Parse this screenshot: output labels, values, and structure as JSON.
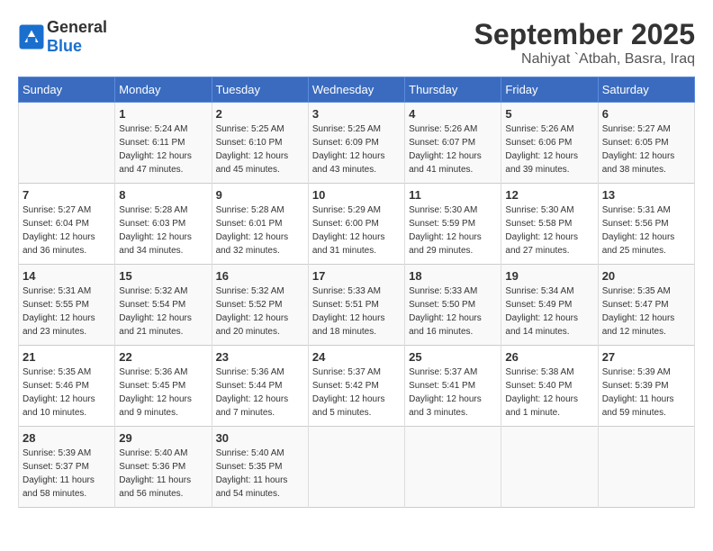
{
  "header": {
    "logo_general": "General",
    "logo_blue": "Blue",
    "month": "September 2025",
    "location": "Nahiyat `Atbah, Basra, Iraq"
  },
  "days_of_week": [
    "Sunday",
    "Monday",
    "Tuesday",
    "Wednesday",
    "Thursday",
    "Friday",
    "Saturday"
  ],
  "weeks": [
    [
      {
        "day": "",
        "info": ""
      },
      {
        "day": "1",
        "info": "Sunrise: 5:24 AM\nSunset: 6:11 PM\nDaylight: 12 hours\nand 47 minutes."
      },
      {
        "day": "2",
        "info": "Sunrise: 5:25 AM\nSunset: 6:10 PM\nDaylight: 12 hours\nand 45 minutes."
      },
      {
        "day": "3",
        "info": "Sunrise: 5:25 AM\nSunset: 6:09 PM\nDaylight: 12 hours\nand 43 minutes."
      },
      {
        "day": "4",
        "info": "Sunrise: 5:26 AM\nSunset: 6:07 PM\nDaylight: 12 hours\nand 41 minutes."
      },
      {
        "day": "5",
        "info": "Sunrise: 5:26 AM\nSunset: 6:06 PM\nDaylight: 12 hours\nand 39 minutes."
      },
      {
        "day": "6",
        "info": "Sunrise: 5:27 AM\nSunset: 6:05 PM\nDaylight: 12 hours\nand 38 minutes."
      }
    ],
    [
      {
        "day": "7",
        "info": "Sunrise: 5:27 AM\nSunset: 6:04 PM\nDaylight: 12 hours\nand 36 minutes."
      },
      {
        "day": "8",
        "info": "Sunrise: 5:28 AM\nSunset: 6:03 PM\nDaylight: 12 hours\nand 34 minutes."
      },
      {
        "day": "9",
        "info": "Sunrise: 5:28 AM\nSunset: 6:01 PM\nDaylight: 12 hours\nand 32 minutes."
      },
      {
        "day": "10",
        "info": "Sunrise: 5:29 AM\nSunset: 6:00 PM\nDaylight: 12 hours\nand 31 minutes."
      },
      {
        "day": "11",
        "info": "Sunrise: 5:30 AM\nSunset: 5:59 PM\nDaylight: 12 hours\nand 29 minutes."
      },
      {
        "day": "12",
        "info": "Sunrise: 5:30 AM\nSunset: 5:58 PM\nDaylight: 12 hours\nand 27 minutes."
      },
      {
        "day": "13",
        "info": "Sunrise: 5:31 AM\nSunset: 5:56 PM\nDaylight: 12 hours\nand 25 minutes."
      }
    ],
    [
      {
        "day": "14",
        "info": "Sunrise: 5:31 AM\nSunset: 5:55 PM\nDaylight: 12 hours\nand 23 minutes."
      },
      {
        "day": "15",
        "info": "Sunrise: 5:32 AM\nSunset: 5:54 PM\nDaylight: 12 hours\nand 21 minutes."
      },
      {
        "day": "16",
        "info": "Sunrise: 5:32 AM\nSunset: 5:52 PM\nDaylight: 12 hours\nand 20 minutes."
      },
      {
        "day": "17",
        "info": "Sunrise: 5:33 AM\nSunset: 5:51 PM\nDaylight: 12 hours\nand 18 minutes."
      },
      {
        "day": "18",
        "info": "Sunrise: 5:33 AM\nSunset: 5:50 PM\nDaylight: 12 hours\nand 16 minutes."
      },
      {
        "day": "19",
        "info": "Sunrise: 5:34 AM\nSunset: 5:49 PM\nDaylight: 12 hours\nand 14 minutes."
      },
      {
        "day": "20",
        "info": "Sunrise: 5:35 AM\nSunset: 5:47 PM\nDaylight: 12 hours\nand 12 minutes."
      }
    ],
    [
      {
        "day": "21",
        "info": "Sunrise: 5:35 AM\nSunset: 5:46 PM\nDaylight: 12 hours\nand 10 minutes."
      },
      {
        "day": "22",
        "info": "Sunrise: 5:36 AM\nSunset: 5:45 PM\nDaylight: 12 hours\nand 9 minutes."
      },
      {
        "day": "23",
        "info": "Sunrise: 5:36 AM\nSunset: 5:44 PM\nDaylight: 12 hours\nand 7 minutes."
      },
      {
        "day": "24",
        "info": "Sunrise: 5:37 AM\nSunset: 5:42 PM\nDaylight: 12 hours\nand 5 minutes."
      },
      {
        "day": "25",
        "info": "Sunrise: 5:37 AM\nSunset: 5:41 PM\nDaylight: 12 hours\nand 3 minutes."
      },
      {
        "day": "26",
        "info": "Sunrise: 5:38 AM\nSunset: 5:40 PM\nDaylight: 12 hours\nand 1 minute."
      },
      {
        "day": "27",
        "info": "Sunrise: 5:39 AM\nSunset: 5:39 PM\nDaylight: 11 hours\nand 59 minutes."
      }
    ],
    [
      {
        "day": "28",
        "info": "Sunrise: 5:39 AM\nSunset: 5:37 PM\nDaylight: 11 hours\nand 58 minutes."
      },
      {
        "day": "29",
        "info": "Sunrise: 5:40 AM\nSunset: 5:36 PM\nDaylight: 11 hours\nand 56 minutes."
      },
      {
        "day": "30",
        "info": "Sunrise: 5:40 AM\nSunset: 5:35 PM\nDaylight: 11 hours\nand 54 minutes."
      },
      {
        "day": "",
        "info": ""
      },
      {
        "day": "",
        "info": ""
      },
      {
        "day": "",
        "info": ""
      },
      {
        "day": "",
        "info": ""
      }
    ]
  ]
}
